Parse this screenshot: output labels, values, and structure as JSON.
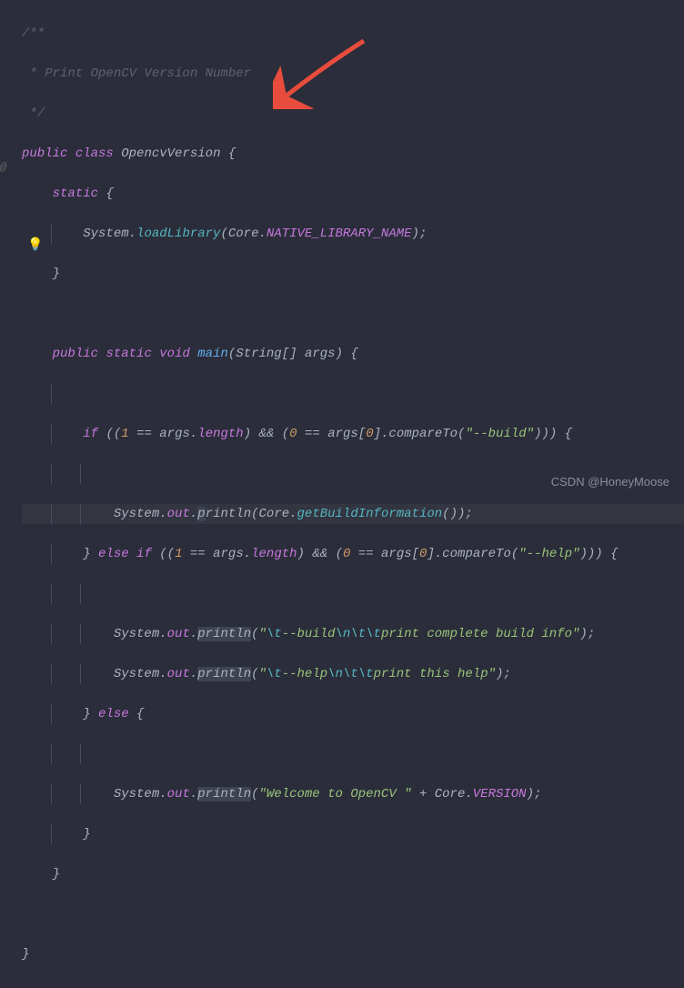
{
  "code": {
    "comment1": "/**",
    "comment2": " * Print OpenCV Version Number",
    "comment3": " */",
    "kw_public": "public",
    "kw_class": "class",
    "class_name": "OpencvVersion",
    "kw_static": "static",
    "system": "System",
    "loadLibrary": "loadLibrary",
    "core": "Core",
    "native_lib": "NATIVE_LIBRARY_NAME",
    "kw_void": "void",
    "main": "main",
    "string_type": "String",
    "args": "args",
    "kw_if": "if",
    "kw_else": "else",
    "num1": "1",
    "num0": "0",
    "eq": "==",
    "length": "length",
    "and": "&&",
    "compareTo": "compareTo",
    "str_build": "\"--build\"",
    "str_help": "\"--help\"",
    "out": "out",
    "println_p": "p",
    "println_rest": "rintln",
    "println": "println",
    "getBuildInfo": "getBuildInformation",
    "esc_t": "\\t",
    "esc_n": "\\n",
    "str_build_mid": "--build",
    "str_build_end": "print complete build info\"",
    "str_help_mid": "--help",
    "str_help_end": "print this help\"",
    "str_welcome": "\"Welcome to OpenCV \"",
    "plus": "+",
    "version": "VERSION"
  },
  "watermark": "CSDN @HoneyMoose"
}
